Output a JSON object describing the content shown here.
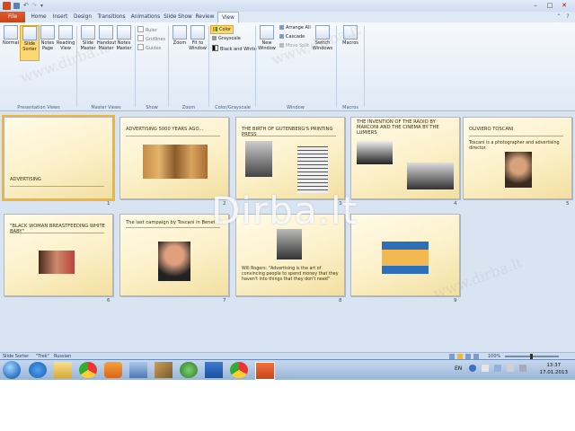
{
  "window": {
    "title": ""
  },
  "tabs": [
    "File",
    "Home",
    "Insert",
    "Design",
    "Transitions",
    "Animations",
    "Slide Show",
    "Review",
    "View"
  ],
  "active_tab": "View",
  "ribbon": {
    "presentation_views": {
      "label": "Presentation Views",
      "buttons": [
        "Normal",
        "Slide Sorter",
        "Notes Page",
        "Reading View"
      ]
    },
    "master_views": {
      "label": "Master Views",
      "buttons": [
        "Slide Master",
        "Handout Master",
        "Notes Master"
      ]
    },
    "show": {
      "label": "Show",
      "items": [
        "Ruler",
        "Gridlines",
        "Guides"
      ]
    },
    "zoom": {
      "label": "Zoom",
      "buttons": [
        "Zoom",
        "Fit to Window"
      ]
    },
    "color": {
      "label": "Color/Grayscale",
      "buttons": [
        "Color",
        "Grayscale",
        "Black and White"
      ]
    },
    "window": {
      "label": "Window",
      "new_window": "New Window",
      "items": [
        "Arrange All",
        "Cascade",
        "Move Split"
      ],
      "switch": "Switch Windows"
    },
    "macros": {
      "label": "Macros",
      "button": "Macros"
    }
  },
  "slides": [
    {
      "num": "1",
      "title": "ADVERTISING"
    },
    {
      "num": "2",
      "title": "ADVERTISING 5000 YEARS AGO..."
    },
    {
      "num": "3",
      "title": "THE BIRTH OF GUTENBERG'S PRINTING PRESS"
    },
    {
      "num": "4",
      "title": "THE INVENTION OF THE RADIO BY MARCONI AND THE CINEMA BY THE LUMIERS"
    },
    {
      "num": "5",
      "title": "OLIVIERO TOSCANI",
      "body": "Toscani is a photographer and advertising director."
    },
    {
      "num": "6",
      "title": "\"BLACK WOMAN BREASTFEEDING WHITE BABY\""
    },
    {
      "num": "7",
      "title": "The last campaign by Toscani in Benetton"
    },
    {
      "num": "8",
      "title": "",
      "body": "Will Rogers: \"Advertising is the art of convincing people to spend money that they haven't into things that they don't need\""
    },
    {
      "num": "9",
      "title": ""
    }
  ],
  "status": {
    "view": "Slide Sorter",
    "theme": "\"Trek\"",
    "language": "Russian",
    "zoom": "100%"
  },
  "clock": {
    "time": "13:37",
    "date": "17.01.2013"
  },
  "tray": {
    "lang": "EN"
  },
  "watermark": "Dirba.lt",
  "watermark_small": "www.dirba.lt"
}
